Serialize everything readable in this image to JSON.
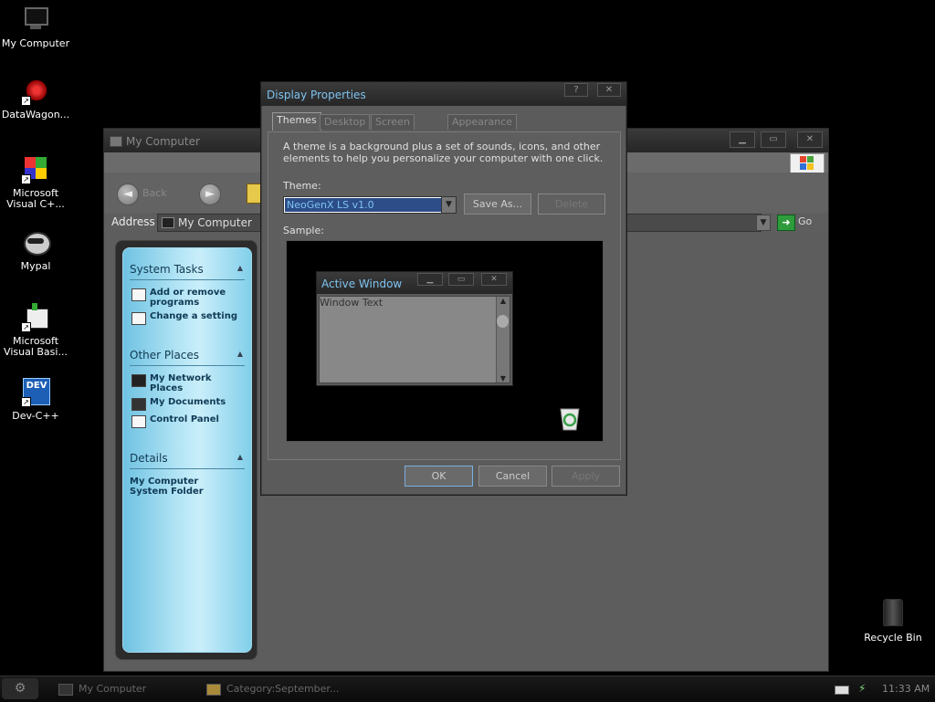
{
  "desktop": {
    "icons": [
      {
        "label": "My Computer"
      },
      {
        "label": "DataWagon..."
      },
      {
        "label": "Microsoft Visual C+..."
      },
      {
        "label": "Mypal"
      },
      {
        "label": "Microsoft Visual Basi..."
      },
      {
        "label": "Dev-C++",
        "badge": "DEV"
      }
    ],
    "recycle_bin": "Recycle Bin"
  },
  "my_computer": {
    "title": "My Computer",
    "back_label": "Back",
    "address_label": "Address",
    "address_value": "My Computer",
    "go_label": "Go",
    "tasks": {
      "system_tasks": {
        "header": "System Tasks",
        "items": [
          "Add or remove programs",
          "Change a setting"
        ]
      },
      "other_places": {
        "header": "Other Places",
        "items": [
          "My Network Places",
          "My Documents",
          "Control Panel"
        ]
      },
      "details": {
        "header": "Details",
        "line1": "My Computer",
        "line2": "System Folder"
      }
    }
  },
  "display_properties": {
    "title": "Display Properties",
    "tabs": [
      "Themes",
      "Desktop",
      "Screen Saver",
      "Appearance"
    ],
    "active_tab": "Themes",
    "description": "A theme is a background plus a set of sounds, icons, and other elements to help you personalize your computer with one click.",
    "theme_label": "Theme:",
    "theme_value": "NeoGenX LS v1.0",
    "save_as": "Save As...",
    "delete": "Delete",
    "sample_label": "Sample:",
    "sample_window": {
      "title": "Active Window",
      "text": "Window Text"
    },
    "buttons": {
      "ok": "OK",
      "cancel": "Cancel",
      "apply": "Apply"
    },
    "title_buttons": {
      "help": "?",
      "close": "✕"
    }
  },
  "taskbar": {
    "start_glyph": "⚙",
    "tasks": [
      "My Computer",
      "Category:September..."
    ],
    "clock": "11:33 AM"
  }
}
